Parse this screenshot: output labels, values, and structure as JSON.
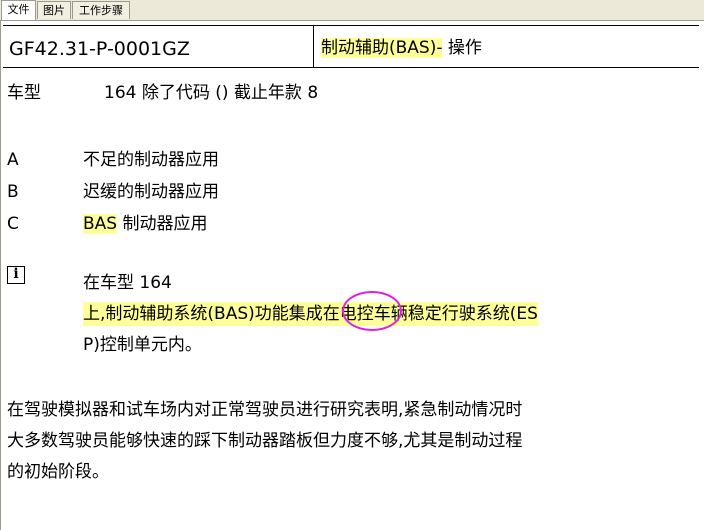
{
  "tabs": [
    {
      "label": "文件",
      "active": true
    },
    {
      "label": "图片",
      "active": false
    },
    {
      "label": "工作步骤",
      "active": false
    }
  ],
  "header": {
    "code": "GF42.31-P-0001GZ",
    "title_highlighted": "制动辅助(BAS)-",
    "title_rest": " 操作"
  },
  "model_line": {
    "label": "车型",
    "value": "164 除了代码 () 截止年款 8"
  },
  "items": [
    {
      "letter": "A",
      "text": "不足的制动器应用"
    },
    {
      "letter": "B",
      "text": "迟缓的制动器应用"
    },
    {
      "letter": "C",
      "text_highlighted": "BAS",
      "text": " 制动器应用"
    }
  ],
  "note": {
    "icon": "info-icon",
    "line1": "在车型 164",
    "line2_pre": "上,制动辅助系统(BAS)功能",
    "line2_marked": "集成",
    "line2_post": "在电控车辆稳定行驶系统(ES",
    "line3": "P)控制单元内。"
  },
  "paragraph": {
    "line1": "在驾驶模拟器和试车场内对正常驾驶员进行研究表明,紧急制动情况时",
    "line2": "大多数驾驶员能够快速的踩下制动器踏板但力度不够,尤其是制动过程",
    "line3": "的初始阶段。"
  },
  "colors": {
    "highlight": "#ffff99",
    "circle": "#e020e0",
    "tabbar": "#ece9d8"
  }
}
